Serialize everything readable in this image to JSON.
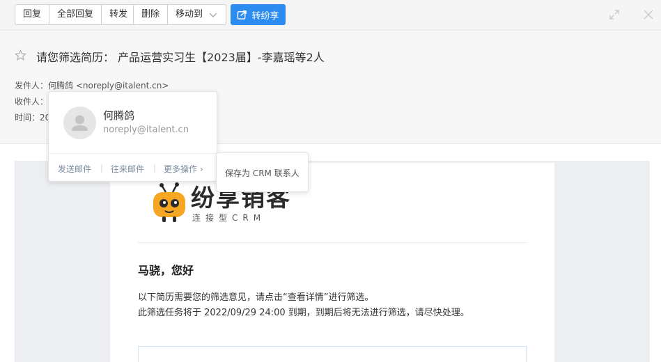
{
  "toolbar": {
    "reply": "回复",
    "reply_all": "全部回复",
    "forward": "转发",
    "delete": "删除",
    "move_to": "移动到",
    "share": "转纷享"
  },
  "header": {
    "subject": "请您筛选简历： 产品运营实习生【2023届】-李嘉瑶等2人",
    "sender_label": "发件人：",
    "sender_value": "何腾鸽 <noreply@italent.cn>",
    "recipient_label": "收件人：",
    "time_label": "时间：",
    "time_value_partial": "20"
  },
  "contact_card": {
    "name": "何腾鸽",
    "email": "noreply@italent.cn",
    "send_mail": "发送邮件",
    "history": "往来邮件",
    "more_actions": "更多操作",
    "sep": "|",
    "more_arrow": "›"
  },
  "submenu": {
    "save_contact": "保存为 CRM 联系人"
  },
  "mail": {
    "logo_text": "纷享销客",
    "logo_sub": "连接型CRM",
    "greeting": "马骁，您好",
    "para1": "以下简历需要您的筛选意见，请点击“查看详情”进行筛选。",
    "para2": "此筛选任务将于 2022/09/29 24:00 到期，到期后将无法进行筛选，请尽快处理。"
  },
  "colors": {
    "accent": "#2d8cf0",
    "logo_yellow": "#f5a623"
  }
}
